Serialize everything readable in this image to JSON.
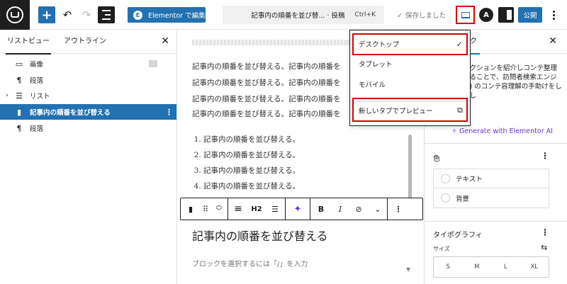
{
  "topbar": {
    "add_label": "+",
    "undo_label": "↶",
    "redo_label": "↷",
    "elementor_label": "Elementor で編集",
    "elementor_icon": "E",
    "doc_title": "記事内の順番を並び替... · 投稿",
    "doc_shortcut": "Ctrl+K",
    "saved_label": "保存しました",
    "saved_check": "✓",
    "astra_label": "A",
    "publish_label": "公開"
  },
  "left_panel": {
    "tabs": [
      "リストビュー",
      "アウトライン"
    ],
    "close_label": "✕",
    "items": [
      {
        "label": "画像",
        "icon": "▭"
      },
      {
        "label": "段落",
        "icon": "¶"
      },
      {
        "label": "リスト",
        "icon": "☰",
        "caret": "›"
      },
      {
        "label": "記事内の順番を並び替える",
        "icon": "▮",
        "more": "⋮"
      },
      {
        "label": "段落",
        "icon": "¶"
      }
    ]
  },
  "editor": {
    "paragraphs": [
      "記事内の順番を並び替える。記事内の順番を",
      "記事内の順番を並び替える。記事内の順番を",
      "記事内の順番を並び替える。記事内の順番を",
      "記事内の順番を並び替える。記事内の順番を"
    ],
    "list_items": [
      "記事内の順番を並び替える。",
      "記事内の順番を並び替える。",
      "記事内の順番を並び替える。",
      "記事内の順番を並び替える。"
    ],
    "toolbar": {
      "bookmark": "▮",
      "drag": "⠿",
      "up": "︿",
      "down": "﹀",
      "align": "≡",
      "heading_level": "H2",
      "justify": "☰",
      "ai": "✦",
      "bold": "B",
      "italic": "I",
      "link": "⊘",
      "more_rich": "⌄",
      "options": "⋮"
    },
    "heading": "記事内の順番を並び替える",
    "placeholder": "ブロックを選択するには「/」を入力",
    "scroll_down": "▼"
  },
  "dropdown": {
    "items": [
      {
        "label": "デスクトップ",
        "mark": "✓"
      },
      {
        "label": "タブレット",
        "mark": ""
      },
      {
        "label": "モバイル",
        "mark": ""
      },
      {
        "label": "新しいタブでプレビュー",
        "mark": "⧉"
      }
    ]
  },
  "right_panel": {
    "tab_label": "ロック",
    "close_label": "✕",
    "description": "セクションを紹介しコンテ整理することで、訪問者検索エンジン) のコンテ容理解の手助けをしまし",
    "generate_label": "Generate with Elementor AI",
    "generate_icon": "✧",
    "color_title": "色",
    "color_more": "⋮",
    "color_rows": [
      "テキスト",
      "背景"
    ],
    "typo_title": "タイポグラフィ",
    "typo_more": "⋮",
    "size_label": "サイズ",
    "size_ctrl": "⇆",
    "size_options": [
      "S",
      "M",
      "L",
      "XL"
    ]
  },
  "colors": {
    "accent": "#2271b1",
    "highlight": "#d60000",
    "ai_purple": "#6b35c9"
  }
}
